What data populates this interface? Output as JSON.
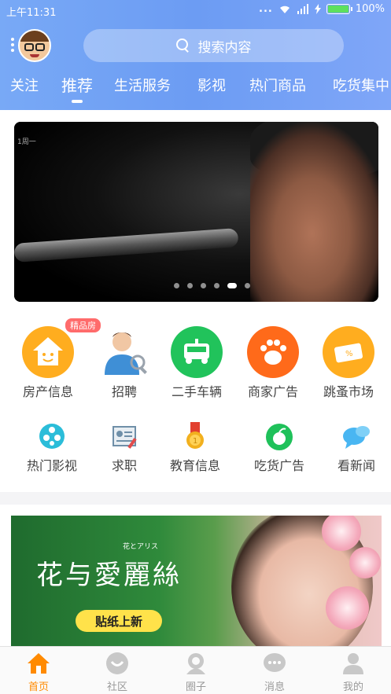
{
  "status_bar": {
    "time": "上午11:31",
    "battery": "100%",
    "dots": "..."
  },
  "header": {
    "search_placeholder": "搜索内容",
    "tabs": [
      {
        "label": "关注",
        "active": false
      },
      {
        "label": "推荐",
        "active": true
      },
      {
        "label": "生活服务",
        "active": false
      },
      {
        "label": "影视",
        "active": false
      },
      {
        "label": "热门商品",
        "active": false
      },
      {
        "label": "吃货集中",
        "active": false
      }
    ]
  },
  "banner": {
    "caption": "1周一",
    "page_count": 6,
    "current_page": 5
  },
  "categories_row1": [
    {
      "label": "房产信息",
      "icon": "house-icon",
      "color": "#ffad1f",
      "badge": "精品房"
    },
    {
      "label": "招聘",
      "icon": "recruit-person-icon",
      "color": "#4aa3df"
    },
    {
      "label": "二手车辆",
      "icon": "car-icon",
      "color": "#21c35b"
    },
    {
      "label": "商家广告",
      "icon": "paw-icon",
      "color": "#ff6a1a"
    },
    {
      "label": "跳蚤市场",
      "icon": "coupon-icon",
      "color": "#ffad1f"
    }
  ],
  "categories_row2": [
    {
      "label": "热门影视",
      "icon": "film-reel-icon",
      "color": "#2bbdd9"
    },
    {
      "label": "求职",
      "icon": "resume-icon",
      "color": "#6f8fa8"
    },
    {
      "label": "教育信息",
      "icon": "medal-icon",
      "color": "#f2b01e"
    },
    {
      "label": "吃货广告",
      "icon": "apple-icon",
      "color": "#1fc15a"
    },
    {
      "label": "看新闻",
      "icon": "chat-bubble-icon",
      "color": "#49b6f2"
    }
  ],
  "ad": {
    "title": "花与愛麗絲",
    "subtitle": "花とアリス",
    "button": "贴纸上新"
  },
  "tabbar": [
    {
      "label": "首页",
      "icon": "home-icon",
      "active": true
    },
    {
      "label": "社区",
      "icon": "community-icon",
      "active": false
    },
    {
      "label": "圈子",
      "icon": "circle-icon",
      "active": false
    },
    {
      "label": "消息",
      "icon": "message-icon",
      "active": false
    },
    {
      "label": "我的",
      "icon": "profile-icon",
      "active": false
    }
  ]
}
